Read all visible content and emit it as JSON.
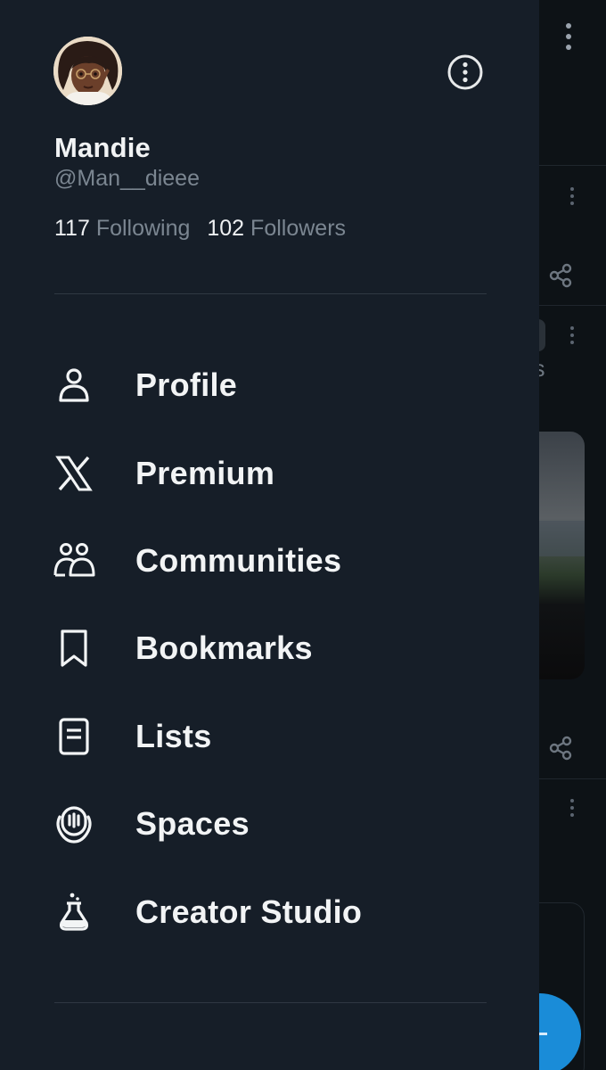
{
  "profile": {
    "display_name": "Mandie",
    "handle": "@Man__dieee",
    "following_count": "117",
    "following_label": "Following",
    "followers_count": "102",
    "followers_label": "Followers"
  },
  "menu": [
    {
      "label": "Profile",
      "icon": "person-icon"
    },
    {
      "label": "Premium",
      "icon": "x-logo-icon"
    },
    {
      "label": "Communities",
      "icon": "people-icon"
    },
    {
      "label": "Bookmarks",
      "icon": "bookmark-icon"
    },
    {
      "label": "Lists",
      "icon": "list-icon"
    },
    {
      "label": "Spaces",
      "icon": "microphone-icon"
    },
    {
      "label": "Creator Studio",
      "icon": "flask-icon"
    }
  ],
  "background": {
    "partial_text": "us"
  },
  "colors": {
    "drawer_bg": "#161e28",
    "text_primary": "#f2f4f5",
    "text_secondary": "#7b8691",
    "divider": "#2f3843",
    "accent": "#1a8cd8"
  }
}
